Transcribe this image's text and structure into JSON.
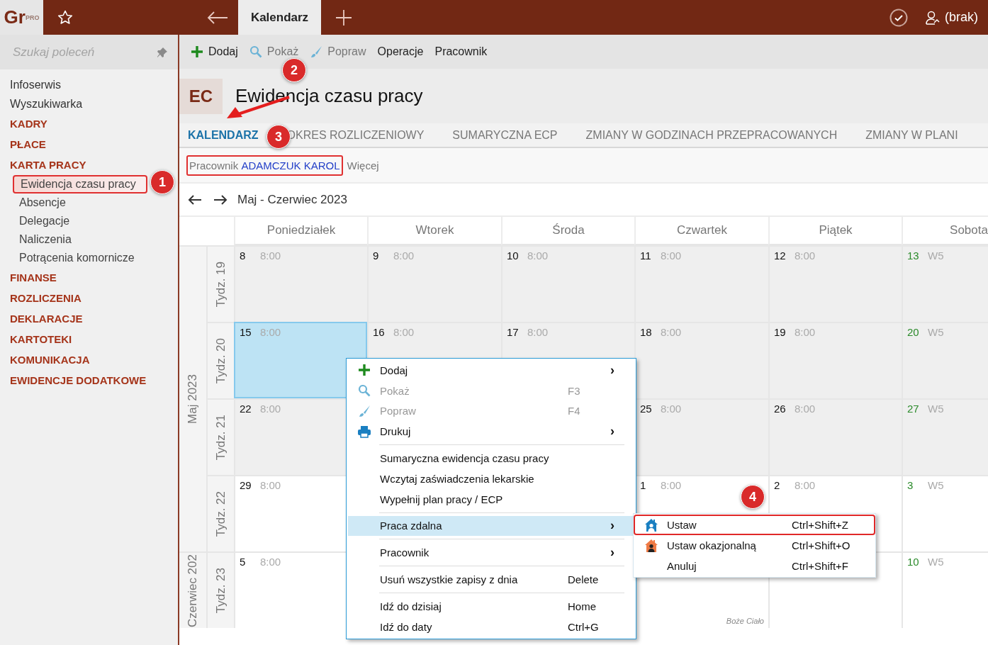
{
  "topbar": {
    "logo": "Gr$^{PRO}$",
    "tab": "Kalendarz",
    "user": "(brak)"
  },
  "sidebar": {
    "search": {
      "placeholder": "Szukaj poleceń"
    },
    "items": [
      {
        "label": "Infoserwis",
        "kind": "link"
      },
      {
        "label": "Wyszukiwarka",
        "kind": "link"
      },
      {
        "label": "KADRY",
        "kind": "section"
      },
      {
        "label": "PŁACE",
        "kind": "section"
      },
      {
        "label": "KARTA PRACY",
        "kind": "section",
        "children": [
          {
            "label": "Ewidencja czasu pracy",
            "selected": true,
            "outlined": true
          },
          {
            "label": "Absencje",
            "selected": false,
            "outlined": false
          },
          {
            "label": "Delegacje",
            "selected": false,
            "outlined": false
          },
          {
            "label": "Naliczenia",
            "selected": false,
            "outlined": false
          },
          {
            "label": "Potrącenia komornicze",
            "selected": false,
            "outlined": false
          }
        ]
      },
      {
        "label": "FINANSE",
        "kind": "section"
      },
      {
        "label": "ROZLICZENIA",
        "kind": "section"
      },
      {
        "label": "DEKLARACJE",
        "kind": "section"
      },
      {
        "label": "KARTOTEKI",
        "kind": "section"
      },
      {
        "label": "KOMUNIKACJA",
        "kind": "section"
      },
      {
        "label": "EWIDENCJE DODATKOWE",
        "kind": "section"
      }
    ]
  },
  "toolbar": [
    {
      "label": "Dodaj",
      "kind": "add",
      "disabled": false
    },
    {
      "label": "Pokaż",
      "kind": "show",
      "disabled": true
    },
    {
      "label": "Popraw",
      "kind": "edit",
      "disabled": true
    },
    {
      "label": "Operacje",
      "disabled": false
    },
    {
      "label": "Pracownik",
      "disabled": false
    }
  ],
  "header": {
    "badge": "EC",
    "title": "Ewidencja czasu pracy"
  },
  "tabs": [
    {
      "label": "KALENDARZ",
      "selected": true
    },
    {
      "label": "OKRES ROZLICZENIOWY",
      "selected": false
    },
    {
      "label": "SUMARYCZNA ECP",
      "selected": false
    },
    {
      "label": "ZMIANY W GODZINACH PRZEPRACOWANYCH",
      "selected": false
    },
    {
      "label": "ZMIANY W PLANI",
      "selected": false
    }
  ],
  "filter": {
    "label": "Pracownik",
    "value": "ADAMCZUK KAROL",
    "outlined": true,
    "more": "Więcej"
  },
  "period": "Maj - Czerwiec 2023",
  "calendar": {
    "days": [
      "Poniedziałek",
      "Wtorek",
      "Środa",
      "Czwartek",
      "Piątek",
      "Sobota"
    ],
    "months": [
      {
        "label": "Maj 2023",
        "weeks": [
          {
            "label": "Tydz. 19",
            "cells": [
              {
                "day": "8",
                "hours": "8:00",
                "shaded": true,
                "weekend": false,
                "selected": false
              },
              {
                "day": "9",
                "hours": "8:00",
                "shaded": true,
                "weekend": false,
                "selected": false
              },
              {
                "day": "10",
                "hours": "8:00",
                "shaded": true,
                "weekend": false,
                "selected": false
              },
              {
                "day": "11",
                "hours": "8:00",
                "shaded": true,
                "weekend": false,
                "selected": false
              },
              {
                "day": "12",
                "hours": "8:00",
                "shaded": true,
                "weekend": false,
                "selected": false
              },
              {
                "day": "13",
                "hours": "W5",
                "shaded": true,
                "weekend": true,
                "selected": false
              }
            ]
          },
          {
            "label": "Tydz. 20",
            "cells": [
              {
                "day": "15",
                "hours": "8:00",
                "shaded": true,
                "weekend": false,
                "selected": true
              },
              {
                "day": "16",
                "hours": "8:00",
                "shaded": true,
                "weekend": false,
                "selected": false
              },
              {
                "day": "17",
                "hours": "8:00",
                "shaded": true,
                "weekend": false,
                "selected": false
              },
              {
                "day": "18",
                "hours": "8:00",
                "shaded": true,
                "weekend": false,
                "selected": false
              },
              {
                "day": "19",
                "hours": "8:00",
                "shaded": true,
                "weekend": false,
                "selected": false
              },
              {
                "day": "20",
                "hours": "W5",
                "shaded": true,
                "weekend": true,
                "selected": false
              }
            ]
          },
          {
            "label": "Tydz. 21",
            "cells": [
              {
                "day": "22",
                "hours": "8:00",
                "shaded": true,
                "weekend": false,
                "selected": false
              },
              {},
              {},
              {
                "day": "25",
                "hours": "8:00",
                "shaded": true,
                "weekend": false,
                "selected": false
              },
              {
                "day": "26",
                "hours": "8:00",
                "shaded": true,
                "weekend": false,
                "selected": false
              },
              {
                "day": "27",
                "hours": "W5",
                "shaded": true,
                "weekend": true,
                "selected": false
              }
            ]
          },
          {
            "label": "Tydz. 22",
            "cells": [
              {
                "day": "29",
                "hours": "8:00",
                "shaded": false,
                "weekend": false,
                "selected": false
              },
              {},
              {},
              {
                "day": "1",
                "hours": "8:00",
                "shaded": false,
                "weekend": false,
                "selected": false
              },
              {
                "day": "2",
                "hours": "8:00",
                "shaded": false,
                "weekend": false,
                "selected": false
              },
              {
                "day": "3",
                "hours": "W5",
                "shaded": false,
                "weekend": true,
                "selected": false
              }
            ]
          }
        ]
      },
      {
        "label": "Czerwiec 202",
        "weeks": [
          {
            "label": "Tydz. 23",
            "cells": [
              {
                "day": "5",
                "hours": "8:00",
                "shaded": false,
                "weekend": false,
                "selected": false
              },
              {},
              {},
              {
                "note": "Boże Ciało",
                "shaded": false
              },
              {
                "shaded": false
              },
              {
                "day": "10",
                "hours": "W5",
                "shaded": false,
                "weekend": true,
                "selected": false
              }
            ]
          }
        ]
      }
    ]
  },
  "context_menu": [
    {
      "kind": "add",
      "label": "Dodaj",
      "submenu": "›",
      "disabled": false,
      "selected": false
    },
    {
      "kind": "show",
      "label": "Pokaż",
      "shortcut": "F3",
      "disabled": true,
      "selected": false
    },
    {
      "kind": "edit",
      "label": "Popraw",
      "shortcut": "F4",
      "disabled": true,
      "selected": false
    },
    {
      "kind": "print",
      "label": "Drukuj",
      "submenu": "›",
      "disabled": false,
      "selected": false
    },
    {
      "kind": "separator"
    },
    {
      "kind": "item",
      "label": "Sumaryczna ewidencja czasu pracy",
      "disabled": false,
      "selected": false
    },
    {
      "kind": "item",
      "label": "Wczytaj zaświadczenia lekarskie",
      "disabled": false,
      "selected": false
    },
    {
      "kind": "item",
      "label": "Wypełnij plan pracy / ECP",
      "disabled": false,
      "selected": false
    },
    {
      "kind": "separator"
    },
    {
      "kind": "item",
      "label": "Praca zdalna",
      "submenu": "›",
      "disabled": false,
      "selected": true
    },
    {
      "kind": "separator"
    },
    {
      "kind": "item",
      "label": "Pracownik",
      "submenu": "›",
      "disabled": false,
      "selected": false
    },
    {
      "kind": "separator"
    },
    {
      "kind": "item",
      "label": "Usuń wszystkie zapisy z dnia",
      "shortcut": "Delete",
      "disabled": false,
      "selected": false
    },
    {
      "kind": "separator"
    },
    {
      "kind": "item",
      "label": "Idź do dzisiaj",
      "shortcut": "Home",
      "disabled": false,
      "selected": false
    },
    {
      "kind": "item",
      "label": "Idź do daty",
      "shortcut": "Ctrl+G",
      "disabled": false,
      "selected": false
    }
  ],
  "submenu": [
    {
      "kind": "set",
      "label": "Ustaw",
      "shortcut": "Ctrl+Shift+Z",
      "outlined": true
    },
    {
      "kind": "occasional",
      "label": "Ustaw okazjonalną",
      "shortcut": "Ctrl+Shift+O",
      "outlined": false
    },
    {
      "kind": "cancel",
      "label": "Anuluj",
      "shortcut": "Ctrl+Shift+F",
      "outlined": false
    }
  ],
  "callouts": [
    "1",
    "2",
    "3",
    "4"
  ]
}
